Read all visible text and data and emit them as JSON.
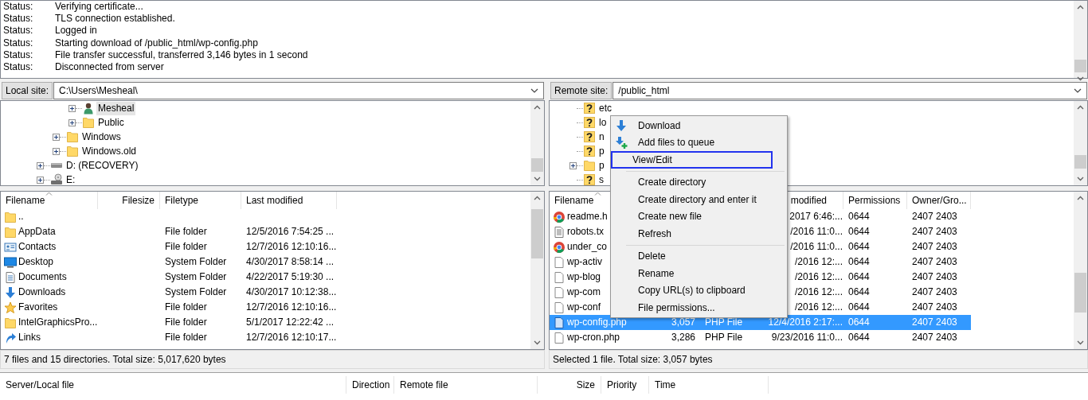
{
  "log": {
    "lines": [
      {
        "type": "Status:",
        "message": "Verifying certificate..."
      },
      {
        "type": "Status:",
        "message": "TLS connection established."
      },
      {
        "type": "Status:",
        "message": "Logged in"
      },
      {
        "type": "Status:",
        "message": "Starting download of /public_html/wp-config.php"
      },
      {
        "type": "Status:",
        "message": "File transfer successful, transferred 3,146 bytes in 1 second"
      },
      {
        "type": "Status:",
        "message": "Disconnected from server"
      }
    ]
  },
  "local": {
    "site_label": "Local site:",
    "path": "C:\\Users\\Mesheal\\",
    "tree": [
      {
        "children": [
          {
            "children": [
              {
                "label": "Mesheal",
                "kind": "user",
                "selected": true,
                "expanded": false
              },
              {
                "label": "Public",
                "kind": "folder",
                "selected": false,
                "expanded": false
              }
            ]
          },
          {
            "label": "Windows",
            "kind": "folder",
            "selected": false,
            "expanded": false
          },
          {
            "label": "Windows.old",
            "kind": "folder",
            "selected": false,
            "expanded": false
          }
        ]
      },
      {
        "label": "D: (RECOVERY)",
        "kind": "drive",
        "selected": false,
        "expanded": false
      },
      {
        "label": "E:",
        "kind": "cd-drive",
        "selected": false,
        "expanded": false
      }
    ],
    "headers": {
      "name": "Filename",
      "size": "Filesize",
      "type": "Filetype",
      "modified": "Last modified"
    },
    "rows": [
      {
        "kind": "folder",
        "name": ".."
      },
      {
        "kind": "folder",
        "name": "AppData",
        "type": "File folder",
        "modified": "12/5/2016 7:54:25 ..."
      },
      {
        "kind": "contacts",
        "name": "Contacts",
        "type": "File folder",
        "modified": "12/7/2016 12:10:16..."
      },
      {
        "kind": "desktop",
        "name": "Desktop",
        "type": "System Folder",
        "modified": "4/30/2017 8:58:14 ..."
      },
      {
        "kind": "documents",
        "name": "Documents",
        "type": "System Folder",
        "modified": "4/22/2017 5:19:30 ..."
      },
      {
        "kind": "downloads",
        "name": "Downloads",
        "type": "System Folder",
        "modified": "4/30/2017 10:12:38..."
      },
      {
        "kind": "favorites",
        "name": "Favorites",
        "type": "File folder",
        "modified": "12/7/2016 12:10:16..."
      },
      {
        "kind": "folder",
        "name": "IntelGraphicsPro...",
        "type": "File folder",
        "modified": "5/1/2017 12:22:42 ..."
      },
      {
        "kind": "links",
        "name": "Links",
        "type": "File folder",
        "modified": "12/7/2016 12:10:17..."
      }
    ],
    "status": "7 files and 15 directories. Total size: 5,017,620 bytes"
  },
  "remote": {
    "site_label": "Remote site:",
    "path": "/public_html",
    "tree": [
      {
        "label": "etc",
        "kind": "unknown"
      },
      {
        "label": "lo",
        "kind": "unknown"
      },
      {
        "label": "n",
        "kind": "unknown"
      },
      {
        "label": "p",
        "kind": "unknown"
      },
      {
        "label": "p",
        "kind": "folder",
        "expanded": false
      },
      {
        "label": "s",
        "kind": "unknown"
      }
    ],
    "headers": {
      "name": "Filename",
      "modified": "modified",
      "permissions": "Permissions",
      "owner": "Owner/Gro..."
    },
    "rows": [
      {
        "kind": "browser",
        "name": "readme.h",
        "modified": "2017 6:46:...",
        "permissions": "0644",
        "owner": "2407 2403",
        "selected": false
      },
      {
        "kind": "text",
        "name": "robots.tx",
        "modified": "/2016 11:0...",
        "permissions": "0644",
        "owner": "2407 2403",
        "selected": false
      },
      {
        "kind": "browser",
        "name": "under_co",
        "modified": "/2016 11:0...",
        "permissions": "0644",
        "owner": "2407 2403",
        "selected": false
      },
      {
        "kind": "file",
        "name": "wp-activ",
        "modified": "/2016 12:...",
        "permissions": "0644",
        "owner": "2407 2403",
        "selected": false
      },
      {
        "kind": "file",
        "name": "wp-blog",
        "modified": "/2016 12:...",
        "permissions": "0644",
        "owner": "2407 2403",
        "selected": false
      },
      {
        "kind": "file",
        "name": "wp-com",
        "modified": "/2016 12:...",
        "permissions": "0644",
        "owner": "2407 2403",
        "selected": false
      },
      {
        "kind": "file",
        "name": "wp-conf",
        "modified": "/2016 12:...",
        "permissions": "0644",
        "owner": "2407 2403",
        "selected": false
      },
      {
        "kind": "file",
        "name": "wp-config.php",
        "size": "3,057",
        "type": "PHP File",
        "modified": "12/4/2016 2:17:...",
        "permissions": "0644",
        "owner": "2407 2403",
        "selected": true
      },
      {
        "kind": "file",
        "name": "wp-cron.php",
        "size": "3,286",
        "type": "PHP File",
        "modified": "9/23/2016 11:0...",
        "permissions": "0644",
        "owner": "2407 2403",
        "selected": false
      }
    ],
    "status": "Selected 1 file. Total size: 3,057 bytes"
  },
  "context_menu": {
    "items": [
      {
        "kind": "download",
        "label": "Download",
        "selected": false
      },
      {
        "kind": "enqueue",
        "label": "Add files to queue",
        "selected": false
      },
      {
        "kind": "command",
        "label": "View/Edit",
        "selected": true
      },
      {
        "kind": "separator"
      },
      {
        "kind": "command",
        "label": "Create directory",
        "selected": false
      },
      {
        "kind": "command",
        "label": "Create directory and enter it",
        "selected": false
      },
      {
        "kind": "command",
        "label": "Create new file",
        "selected": false
      },
      {
        "kind": "command",
        "label": "Refresh",
        "selected": false
      },
      {
        "kind": "separator"
      },
      {
        "kind": "command",
        "label": "Delete",
        "selected": false
      },
      {
        "kind": "command",
        "label": "Rename",
        "selected": false
      },
      {
        "kind": "command",
        "label": "Copy URL(s) to clipboard",
        "selected": false
      },
      {
        "kind": "command",
        "label": "File permissions...",
        "selected": false
      }
    ]
  },
  "queue": {
    "columns": [
      "Server/Local file",
      "Direction",
      "Remote file",
      "Size",
      "Priority",
      "Time"
    ]
  }
}
